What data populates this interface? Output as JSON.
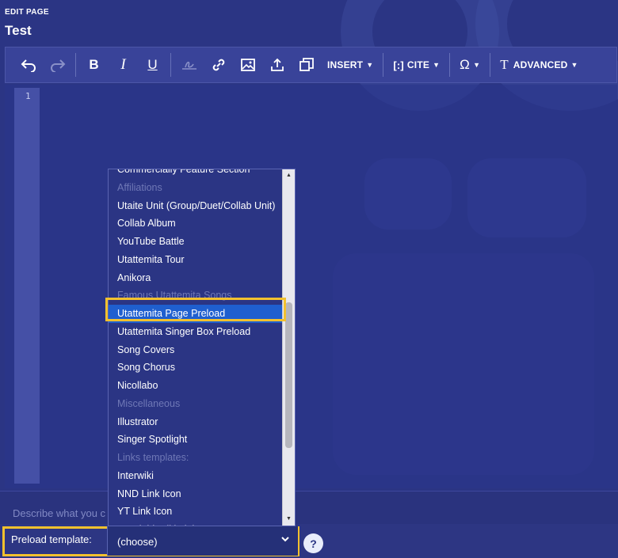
{
  "header": {
    "edit_label": "EDIT PAGE",
    "title": "Test"
  },
  "toolbar": {
    "insert_label": "INSERT",
    "cite_label": "CITE",
    "advanced_label": "ADVANCED"
  },
  "editor": {
    "line_number": "1"
  },
  "summary": {
    "placeholder": "Describe what you c"
  },
  "preload": {
    "label": "Preload template:",
    "selected_value": "(choose)",
    "help": "?"
  },
  "dropdown": {
    "items": [
      {
        "label": "Commercially Feature Section",
        "type": "option"
      },
      {
        "label": "Affiliations",
        "type": "group"
      },
      {
        "label": "Utaite Unit (Group/Duet/Collab Unit)",
        "type": "option"
      },
      {
        "label": "Collab Album",
        "type": "option"
      },
      {
        "label": "YouTube Battle",
        "type": "option"
      },
      {
        "label": "Utattemita Tour",
        "type": "option"
      },
      {
        "label": "Anikora",
        "type": "option"
      },
      {
        "label": "Famous Utattemita Songs",
        "type": "group"
      },
      {
        "label": "Utattemita Page Preload",
        "type": "option",
        "selected": true
      },
      {
        "label": "Utattemita Singer Box Preload",
        "type": "option"
      },
      {
        "label": "Song Covers",
        "type": "option"
      },
      {
        "label": "Song Chorus",
        "type": "option"
      },
      {
        "label": "Nicollabo",
        "type": "option"
      },
      {
        "label": "Miscellaneous",
        "type": "group"
      },
      {
        "label": "Illustrator",
        "type": "option"
      },
      {
        "label": "Singer Spotlight",
        "type": "option"
      },
      {
        "label": "Links templates:",
        "type": "group"
      },
      {
        "label": "Interwiki",
        "type": "option"
      },
      {
        "label": "NND Link Icon",
        "type": "option"
      },
      {
        "label": "YT Link Icon",
        "type": "option"
      },
      {
        "label": "Vocaloid Wiki Link",
        "type": "option"
      }
    ]
  },
  "colors": {
    "background": "#2b3584",
    "highlight": "#f2c12e",
    "selected": "#1f5fcf"
  }
}
